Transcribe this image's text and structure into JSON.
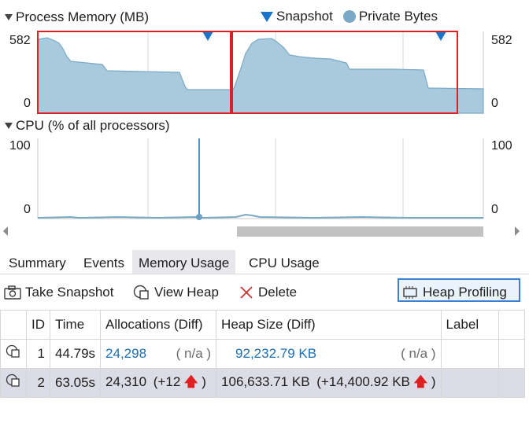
{
  "memory": {
    "title": "Process Memory (MB)",
    "legend_snapshot": "Snapshot",
    "legend_private": "Private Bytes",
    "y_max": "582",
    "y_min": "0"
  },
  "cpu": {
    "title": "CPU (% of all processors)",
    "y_max": "100",
    "y_min": "0"
  },
  "tabs": [
    {
      "label": "Summary"
    },
    {
      "label": "Events"
    },
    {
      "label": "Memory Usage"
    },
    {
      "label": "CPU Usage"
    }
  ],
  "toolbar": {
    "take_snapshot": "Take Snapshot",
    "view_heap": "View Heap",
    "delete": "Delete",
    "heap_profiling": "Heap Profiling"
  },
  "table": {
    "headers": [
      "ID",
      "Time",
      "Allocations (Diff)",
      "Heap Size (Diff)",
      "Label"
    ],
    "rows": [
      {
        "id": "1",
        "time": "44.79s",
        "alloc": "24,298",
        "alloc_diff": "( n/a )",
        "heap": "92,232.79 KB",
        "heap_diff": "( n/a )"
      },
      {
        "id": "2",
        "time": "63.05s",
        "alloc": "24,310",
        "alloc_diff_pre": "(+12",
        "alloc_diff_post": ")",
        "heap": "106,633.71 KB",
        "heap_diff_pre": "(+14,400.92 KB",
        "heap_diff_post": ")"
      }
    ]
  },
  "colors": {
    "area_fill": "#a9c9dc",
    "area_line": "#7aa9c6",
    "snapshot_marker": "#1a73c9",
    "selection_red": "#e02020",
    "selected_tab": "#e8e8ec"
  }
}
